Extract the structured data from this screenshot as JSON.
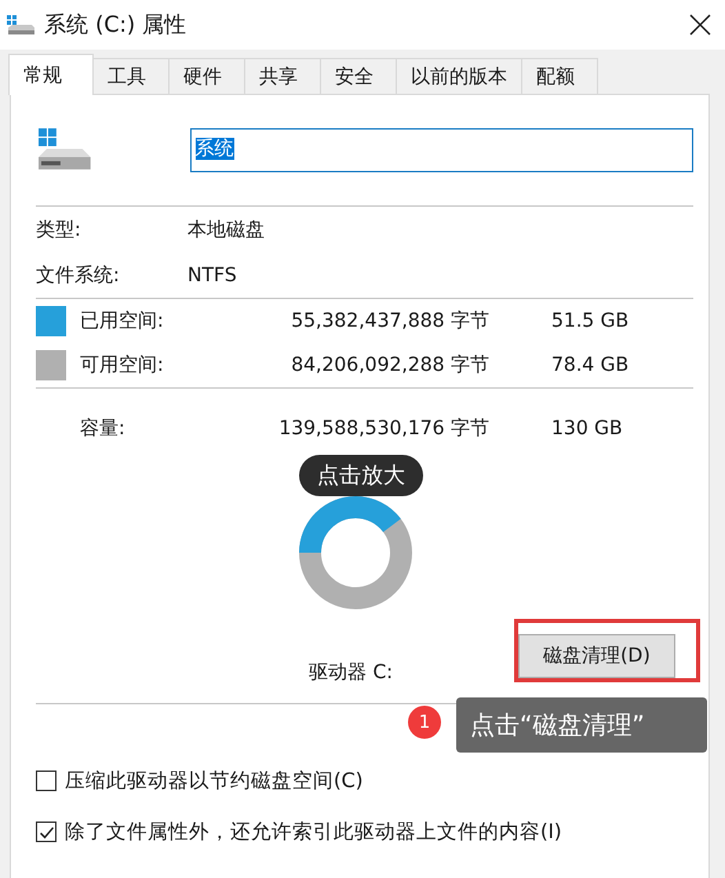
{
  "window": {
    "title": "系统 (C:) 属性"
  },
  "tabs": [
    {
      "label": "常规",
      "selected": true
    },
    {
      "label": "工具",
      "selected": false
    },
    {
      "label": "硬件",
      "selected": false
    },
    {
      "label": "共享",
      "selected": false
    },
    {
      "label": "安全",
      "selected": false
    },
    {
      "label": "以前的版本",
      "selected": false
    },
    {
      "label": "配额",
      "selected": false
    }
  ],
  "drive_name": {
    "value": "系统"
  },
  "properties": [
    {
      "label": "类型:",
      "value": "本地磁盘"
    },
    {
      "label": "文件系统:",
      "value": "NTFS"
    }
  ],
  "space": [
    {
      "label": "已用空间:",
      "bytes": "55,382,437,888 字节",
      "size": "51.5 GB",
      "color": "#26a0da"
    },
    {
      "label": "可用空间:",
      "bytes": "84,206,092,288 字节",
      "size": "78.4 GB",
      "color": "#b0b0b0"
    }
  ],
  "capacity": {
    "label": "容量:",
    "bytes": "139,588,530,176 字节",
    "size": "130 GB"
  },
  "usage_ring": {
    "level": 0.397
  },
  "drive_label": "驱动器 C:",
  "cleanup_button": {
    "label": "磁盘清理(D)"
  },
  "options": [
    {
      "label": "压缩此驱动器以节约磁盘空间(C)",
      "checked": false
    },
    {
      "label": "除了文件属性外，还允许索引此驱动器上文件的内容(I)",
      "checked": true
    }
  ],
  "overlays": {
    "zoom_hint": "点击放大",
    "step": {
      "number": "1",
      "text": "点击“磁盘清理”"
    }
  }
}
